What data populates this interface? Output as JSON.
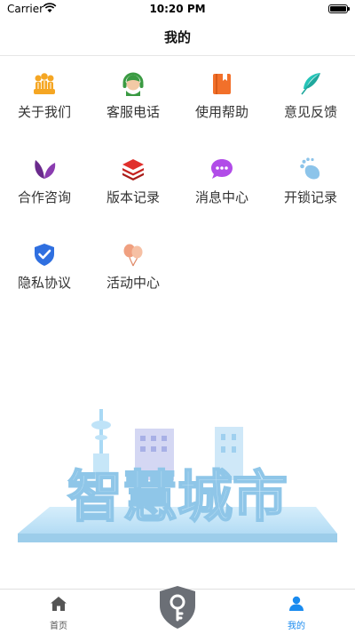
{
  "status_bar": {
    "carrier": "Carrier",
    "time": "10:20 PM"
  },
  "nav": {
    "title": "我的"
  },
  "menu": [
    {
      "label": "关于我们",
      "icon": "people-group-icon",
      "color": "#f5a623"
    },
    {
      "label": "客服电话",
      "icon": "customer-service-icon",
      "color": "#3a9a42"
    },
    {
      "label": "使用帮助",
      "icon": "book-icon",
      "color": "#f2702a"
    },
    {
      "label": "意见反馈",
      "icon": "feather-icon",
      "color": "#25c4b8"
    },
    {
      "label": "合作咨询",
      "icon": "leaf-icon",
      "color": "#6a2a8c"
    },
    {
      "label": "版本记录",
      "icon": "stack-layers-icon",
      "color": "#e0302c"
    },
    {
      "label": "消息中心",
      "icon": "chat-bubble-icon",
      "color": "#b14ce8"
    },
    {
      "label": "开锁记录",
      "icon": "footprint-icon",
      "color": "#8cc4ea"
    },
    {
      "label": "隐私协议",
      "icon": "shield-check-icon",
      "color": "#2f6fe0"
    },
    {
      "label": "活动中心",
      "icon": "balloon-icon",
      "color": "#f0a080"
    }
  ],
  "banner": {
    "text": "智慧城市",
    "icon": "smart-city-illustration"
  },
  "tabs": [
    {
      "label": "首页",
      "icon": "home-icon",
      "active": false
    },
    {
      "label": "我的",
      "icon": "person-icon",
      "active": true
    }
  ],
  "center_button": {
    "icon": "key-shield-icon"
  },
  "colors": {
    "active_tab": "#1a8bef",
    "inactive_tab": "#555555",
    "center_button": "#6b6f76"
  }
}
